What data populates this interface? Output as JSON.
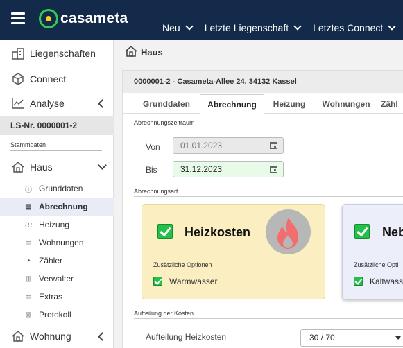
{
  "header": {
    "brand": "casameta",
    "nav": [
      {
        "label": "Neu"
      },
      {
        "label": "Letzte Liegenschaft"
      },
      {
        "label": "Letztes Connect"
      }
    ]
  },
  "sidebar": {
    "liegenschaften": "Liegenschaften",
    "connect": "Connect",
    "analyse": "Analyse",
    "ls_nr": "LS-Nr. 0000001-2",
    "stammdaten": "Stammdaten",
    "haus": "Haus",
    "sub_items": [
      {
        "label": "Grunddaten",
        "icon": "info-icon"
      },
      {
        "label": "Abrechnung",
        "icon": "document-icon"
      },
      {
        "label": "Heizung",
        "icon": "heat-waves-icon"
      },
      {
        "label": "Wohnungen",
        "icon": "apartment-icon"
      },
      {
        "label": "Zähler",
        "icon": "meter-icon"
      },
      {
        "label": "Verwalter",
        "icon": "building-icon"
      },
      {
        "label": "Extras",
        "icon": "laptop-icon"
      },
      {
        "label": "Protokoll",
        "icon": "protocol-icon"
      }
    ],
    "wohnung": "Wohnung"
  },
  "breadcrumb": {
    "title": "Haus"
  },
  "property": {
    "title": "0000001-2 - Casameta-Allee 24, 34132 Kassel"
  },
  "tabs": [
    {
      "label": "Grunddaten"
    },
    {
      "label": "Abrechnung"
    },
    {
      "label": "Heizung"
    },
    {
      "label": "Wohnungen"
    },
    {
      "label": "Zähl"
    }
  ],
  "period": {
    "section": "Abrechnungszeitraum",
    "von_label": "Von",
    "von_value": "01.01.2023",
    "bis_label": "Bis",
    "bis_value": "31.12.2023"
  },
  "art": {
    "section": "Abrechnungsart",
    "heiz": {
      "title": "Heizkosten",
      "options_label": "Zusätzliche Optionen",
      "option": "Warmwasser",
      "checked": true,
      "option_checked": true
    },
    "neb": {
      "title": "Neb",
      "options_label": "Zusätzliche Opti",
      "option": "Kaltwasse",
      "checked": true,
      "option_checked": true
    }
  },
  "aufteilung": {
    "section": "Aufteilung der Kosten",
    "label": "Aufteilung Heizkosten",
    "value": "30 / 70"
  },
  "colors": {
    "header_bg": "#132a4a",
    "brand_green": "#2ecc55",
    "heiz_box": "#fbefc1",
    "neb_box": "#eceef9",
    "check_green": "#25c04a",
    "flame": "#f26d6d"
  }
}
